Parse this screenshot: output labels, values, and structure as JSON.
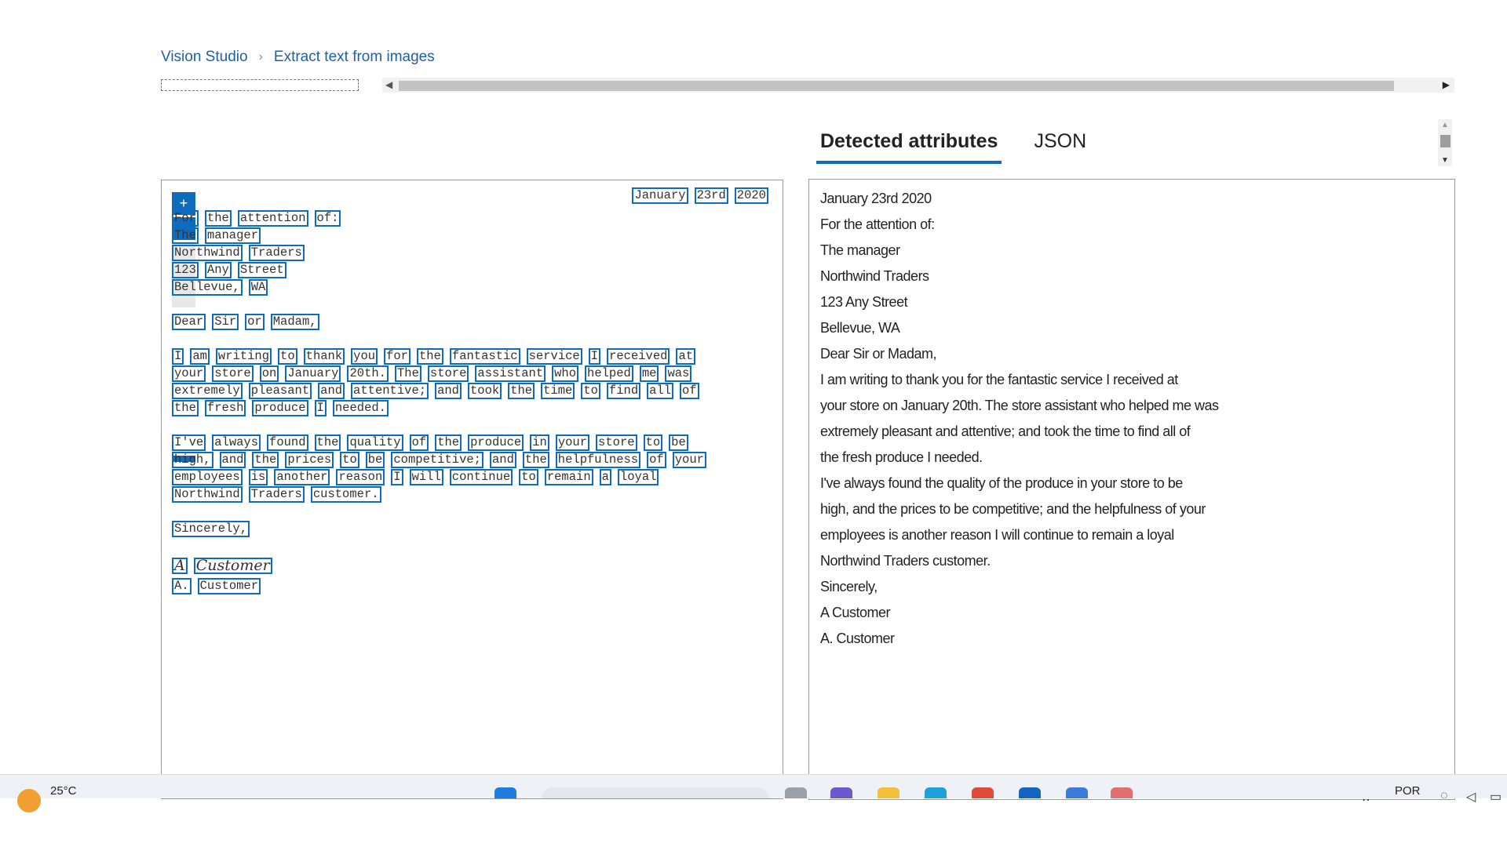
{
  "breadcrumb": {
    "home": "Vision Studio",
    "current": "Extract text from images"
  },
  "tabs": {
    "detected": "Detected attributes",
    "json": "JSON"
  },
  "zoom": {
    "in": "+",
    "out": "−"
  },
  "image": {
    "date": [
      "January",
      "23rd",
      "2020"
    ],
    "lines": [
      [
        "For",
        "the",
        "attention",
        "of:"
      ],
      [
        "The",
        "manager"
      ],
      [
        "Northwind",
        "Traders"
      ],
      [
        "123",
        "Any",
        "Street"
      ],
      [
        "Bellevue,",
        "WA"
      ],
      [
        "Dear",
        "Sir",
        "or",
        "Madam,"
      ],
      [
        "I",
        "am",
        "writing",
        "to",
        "thank",
        "you",
        "for",
        "the",
        "fantastic",
        "service",
        "I",
        "received",
        "at"
      ],
      [
        "your",
        "store",
        "on",
        "January",
        "20th.",
        "The",
        "store",
        "assistant",
        "who",
        "helped",
        "me",
        "was"
      ],
      [
        "extremely",
        "pleasant",
        "and",
        "attentive;",
        "and",
        "took",
        "the",
        "time",
        "to",
        "find",
        "all",
        "of"
      ],
      [
        "the",
        "fresh",
        "produce",
        "I",
        "needed."
      ],
      [
        "I've",
        "always",
        "found",
        "the",
        "quality",
        "of",
        "the",
        "produce",
        "in",
        "your",
        "store",
        "to",
        "be"
      ],
      [
        "high,",
        "and",
        "the",
        "prices",
        "to",
        "be",
        "competitive;",
        "and",
        "the",
        "helpfulness",
        "of",
        "your"
      ],
      [
        "employees",
        "is",
        "another",
        "reason",
        "I",
        "will",
        "continue",
        "to",
        "remain",
        "a",
        "loyal"
      ],
      [
        "Northwind",
        "Traders",
        "customer."
      ],
      [
        "Sincerely,"
      ],
      [
        "A",
        "Customer"
      ],
      [
        "A.",
        "Customer"
      ]
    ]
  },
  "detected_text": [
    "January 23rd 2020",
    "For the attention of:",
    "The manager",
    "Northwind Traders",
    "123 Any Street",
    "Bellevue, WA",
    "Dear Sir or Madam,",
    "I am writing to thank you for the fantastic service I received at",
    "your store on January 20th. The store assistant who helped me was",
    "extremely pleasant and attentive; and took the time to find all of",
    "the fresh produce I needed.",
    "I've always found the quality of the produce in your store to be",
    "high, and the prices to be competitive; and the helpfulness of your",
    "employees is another reason I will continue to remain a loyal",
    "Northwind Traders customer.",
    "Sincerely,",
    "A Customer",
    "A. Customer"
  ],
  "taskbar": {
    "temperature": "25°C",
    "language": "POR"
  },
  "icons": {
    "weather": "weather-sun-icon",
    "scroll_left": "arrow-left-icon",
    "scroll_right": "arrow-right-icon"
  }
}
